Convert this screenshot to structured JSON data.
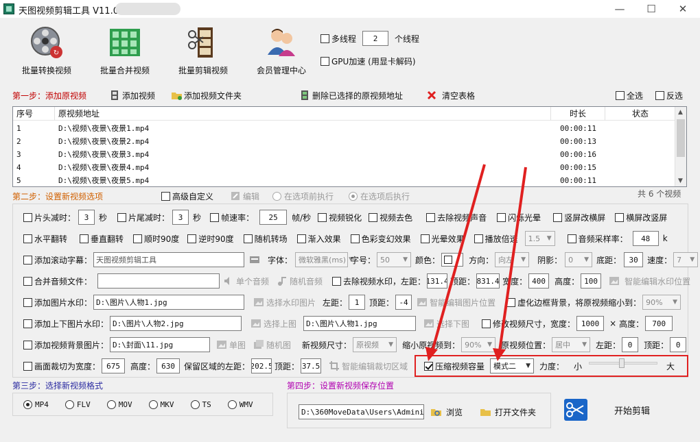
{
  "window": {
    "title": "天图视频剪辑工具 V11.0",
    "minimize": "—",
    "maximize": "☐",
    "close": "✕"
  },
  "toolbar": {
    "batch_convert": "批量转换视频",
    "batch_merge": "批量合并视频",
    "batch_edit": "批量剪辑视频",
    "member_center": "会员管理中心",
    "multithread_label": "多线程",
    "thread_count": "2",
    "thread_unit": "个线程",
    "gpu_label": "GPU加速 (用显卡解码)"
  },
  "step1": {
    "label": "第一步：添加原视频",
    "add_video": "添加视频",
    "add_folder": "添加视频文件夹",
    "delete_selected": "删除已选择的原视频地址",
    "clear_table": "清空表格",
    "select_all": "全选",
    "invert_select": "反选"
  },
  "table": {
    "headers": {
      "index": "序号",
      "path": "原视频地址",
      "duration": "时长",
      "status": "状态"
    },
    "rows": [
      {
        "index": "1",
        "path": "D:\\视频\\夜景\\夜景1.mp4",
        "duration": "00:00:11",
        "status": ""
      },
      {
        "index": "2",
        "path": "D:\\视频\\夜景\\夜景2.mp4",
        "duration": "00:00:13",
        "status": ""
      },
      {
        "index": "3",
        "path": "D:\\视频\\夜景\\夜景3.mp4",
        "duration": "00:00:16",
        "status": ""
      },
      {
        "index": "4",
        "path": "D:\\视频\\夜景\\夜景4.mp4",
        "duration": "00:00:15",
        "status": ""
      },
      {
        "index": "5",
        "path": "D:\\视频\\夜景\\夜景5.mp4",
        "duration": "00:00:11",
        "status": ""
      }
    ],
    "total": "共 6 个视频"
  },
  "step2": {
    "label": "第二步：设置新视频选项",
    "advanced": "高级自定义",
    "edit": "编辑",
    "before": "在选项前执行",
    "after": "在选项后执行"
  },
  "opts1": {
    "head_cut": "片头减时：",
    "head_val": "3",
    "sec1": "秒",
    "tail_cut": "片尾减时：",
    "tail_val": "3",
    "sec2": "秒",
    "fps_label": "帧速率：",
    "fps_val": "25",
    "fps_unit": "帧/秒",
    "sharpen": "视频锐化",
    "decolor": "视频去色",
    "remove_audio": "去除视频声音",
    "flash": "闪烁光晕",
    "v2h": "竖屏改横屏",
    "h2v": "横屏改竖屏"
  },
  "opts2": {
    "hflip": "水平翻转",
    "vflip": "垂直翻转",
    "rot90": "顺时90度",
    "rot_ccw90": "逆时90度",
    "random_transition": "随机转场",
    "fade_in": "渐入效果",
    "color_change": "色彩变幻效果",
    "halo": "光晕效果",
    "speed": "播放倍速",
    "speed_val": "1.5",
    "sample_rate": "音频采样率：",
    "sample_val": "48",
    "sample_unit": "k"
  },
  "opts3": {
    "scroll_sub": "添加滚动字幕：",
    "sub_text": "天图视频剪辑工具",
    "font_label": "字体：",
    "font_val": "微软雅黑(ms)",
    "size_label": "字号：",
    "size_val": "50",
    "color_label": "颜色：",
    "dir_label": "方向：",
    "dir_val": "向左",
    "shadow_label": "阴影：",
    "shadow_val": "0",
    "bottom_label": "底距：",
    "bottom_val": "30",
    "speed_label": "速度：",
    "speed_val": "7"
  },
  "opts4": {
    "merge_audio": "合并音频文件：",
    "single_audio": "单个音频",
    "random_audio": "随机音频",
    "remove_wm": "去除视频水印，左距：",
    "left_val": "131.4",
    "top_label": "顶距：",
    "top_val": "831.4",
    "w_label": "宽度：",
    "w_val": "400",
    "h_label": "高度：",
    "h_val": "100",
    "smart_wm": "智能编辑水印位置"
  },
  "opts5": {
    "img_wm": "添加图片水印：",
    "img_path": "D:\\图片\\人物1.jpg",
    "select_img": "选择水印图片",
    "left_label": "左距：",
    "left_val": "1",
    "top_label": "顶距：",
    "top_val": "-4",
    "smart_img": "智能编辑图片位置",
    "blur_border": "虚化边框背景，将原视频缩小到：",
    "blur_val": "90%"
  },
  "opts6": {
    "topbottom": "添加上下图片水印：",
    "top_path": "D:\\图片\\人物2.jpg",
    "select_top": "选择上图",
    "bottom_path": "D:\\图片\\人物1.jpg",
    "select_bottom": "选择下图",
    "resize": "修改视频尺寸，宽度：",
    "w_val": "1000",
    "times": "×",
    "h_label": "高度：",
    "h_val": "700"
  },
  "opts7": {
    "bg_img": "添加视频背景图片：",
    "bg_path": "D:\\封面\\11.jpg",
    "single": "单图",
    "random": "随机图",
    "new_size": "新视频尺寸：",
    "new_size_val": "原视频",
    "shrink": "缩小原视频到：",
    "shrink_val": "90%",
    "pos": "原视频位置：",
    "pos_val": "居中",
    "left_label": "左距：",
    "left_val": "0",
    "top_label": "顶距：",
    "top_val": "0"
  },
  "opts8": {
    "crop": "画面裁切为宽度：",
    "crop_w": "675",
    "h_label": "高度：",
    "crop_h": "630",
    "keep_left": "保留区域的左距：",
    "left_val": "202.5",
    "top_label": "顶距：",
    "top_val": "37.5",
    "smart_crop": "智能编辑裁切区域",
    "compress": "压缩视频容量",
    "mode_val": "模式二",
    "strength": "力度：",
    "small": "小",
    "large": "大"
  },
  "step3": {
    "label": "第三步：选择新视频格式",
    "formats": [
      "MP4",
      "FLV",
      "MOV",
      "MKV",
      "TS",
      "WMV"
    ]
  },
  "step4": {
    "label": "第四步：设置新视频保存位置",
    "path": "D:\\360MoveData\\Users\\Administr",
    "browse": "浏览",
    "open_folder": "打开文件夹",
    "start": "开始剪辑"
  },
  "colors": {
    "step_red": "#c00000",
    "step_orange": "#d06000",
    "step_blue": "#2a2aa0",
    "step_purple": "#b000b0",
    "highlight": "#e02020"
  }
}
